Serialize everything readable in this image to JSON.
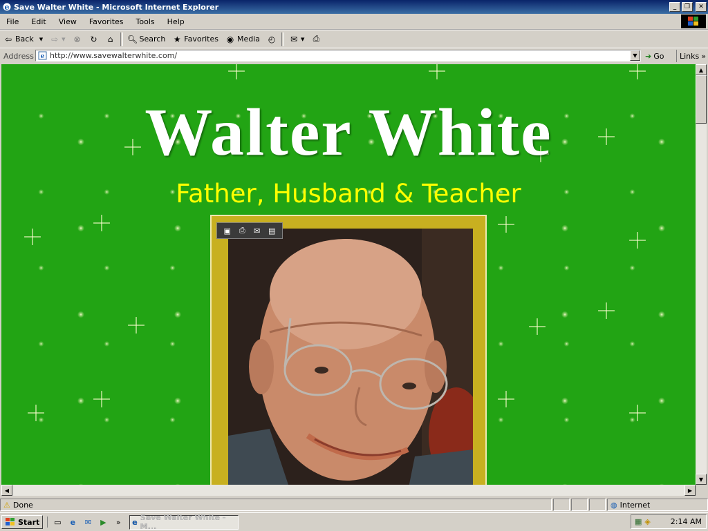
{
  "window": {
    "title": "Save Walter White - Microsoft Internet Explorer",
    "controls": [
      "minimize",
      "maximize",
      "close"
    ]
  },
  "menu": [
    "File",
    "Edit",
    "View",
    "Favorites",
    "Tools",
    "Help"
  ],
  "toolbar": {
    "back_label": "Back",
    "search_label": "Search",
    "favorites_label": "Favorites",
    "media_label": "Media"
  },
  "address": {
    "label": "Address",
    "url": "http://www.savewalterwhite.com/",
    "go_label": "Go",
    "links_label": "Links"
  },
  "page": {
    "title": "Walter White",
    "subtitle": "Father, Husband & Teacher",
    "background_color": "#22a414",
    "title_color": "#ffffff",
    "subtitle_color": "#ffff00",
    "frame_color": "#c8b020"
  },
  "status": {
    "text": "Done",
    "zone": "Internet"
  },
  "taskbar": {
    "start_label": "Start",
    "task_label": "Save Walter White - M...",
    "clock": "2:14 AM"
  }
}
